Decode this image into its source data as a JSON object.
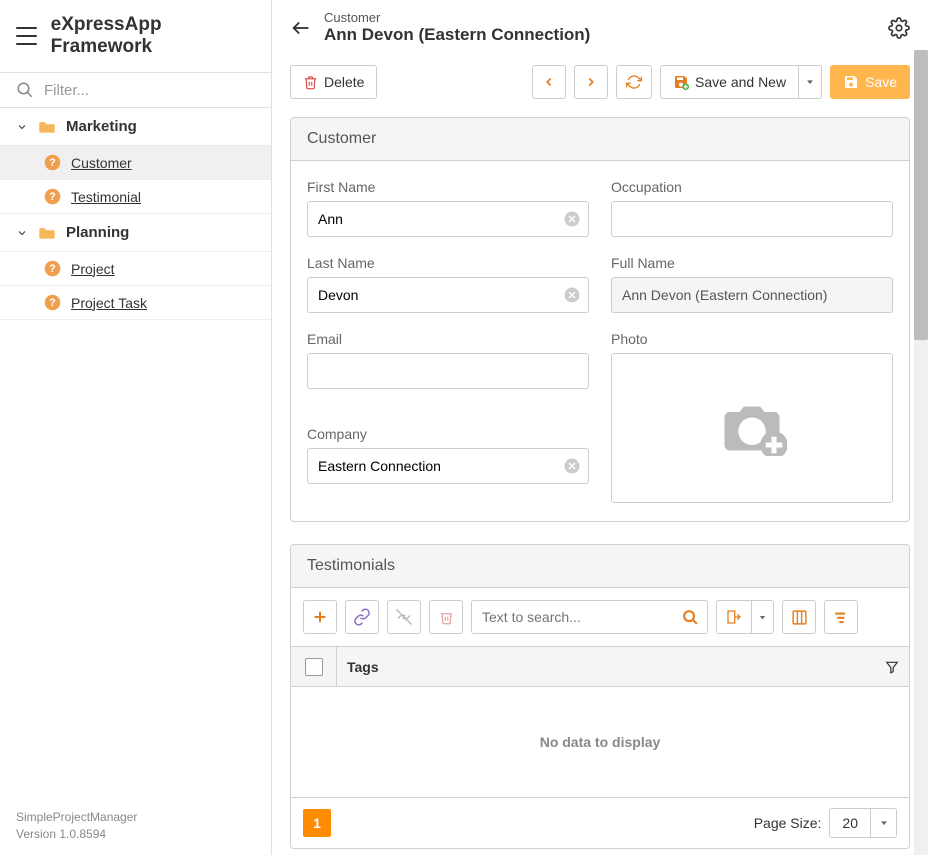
{
  "app_title": "eXpressApp Framework",
  "filter_placeholder": "Filter...",
  "sidebar": {
    "groups": [
      {
        "label": "Marketing",
        "items": [
          {
            "label": "Customer",
            "active": true
          },
          {
            "label": "Testimonial",
            "active": false
          }
        ]
      },
      {
        "label": "Planning",
        "items": [
          {
            "label": "Project",
            "active": false
          },
          {
            "label": "Project Task",
            "active": false
          }
        ]
      }
    ]
  },
  "footer": {
    "app_name": "SimpleProjectManager",
    "version": "Version 1.0.8594"
  },
  "header": {
    "breadcrumb": "Customer",
    "title": "Ann Devon (Eastern Connection)"
  },
  "toolbar": {
    "delete": "Delete",
    "save_and_new": "Save and New",
    "save": "Save"
  },
  "customer_panel": {
    "title": "Customer",
    "fields": {
      "first_name_label": "First Name",
      "first_name_value": "Ann",
      "last_name_label": "Last Name",
      "last_name_value": "Devon",
      "email_label": "Email",
      "email_value": "",
      "company_label": "Company",
      "company_value": "Eastern Connection",
      "occupation_label": "Occupation",
      "occupation_value": "",
      "full_name_label": "Full Name",
      "full_name_value": "Ann Devon (Eastern Connection)",
      "photo_label": "Photo"
    }
  },
  "testimonials_panel": {
    "title": "Testimonials",
    "search_placeholder": "Text to search...",
    "column_tags": "Tags",
    "empty_text": "No data to display",
    "page_current": "1",
    "page_size_label": "Page Size:",
    "page_size_value": "20"
  }
}
